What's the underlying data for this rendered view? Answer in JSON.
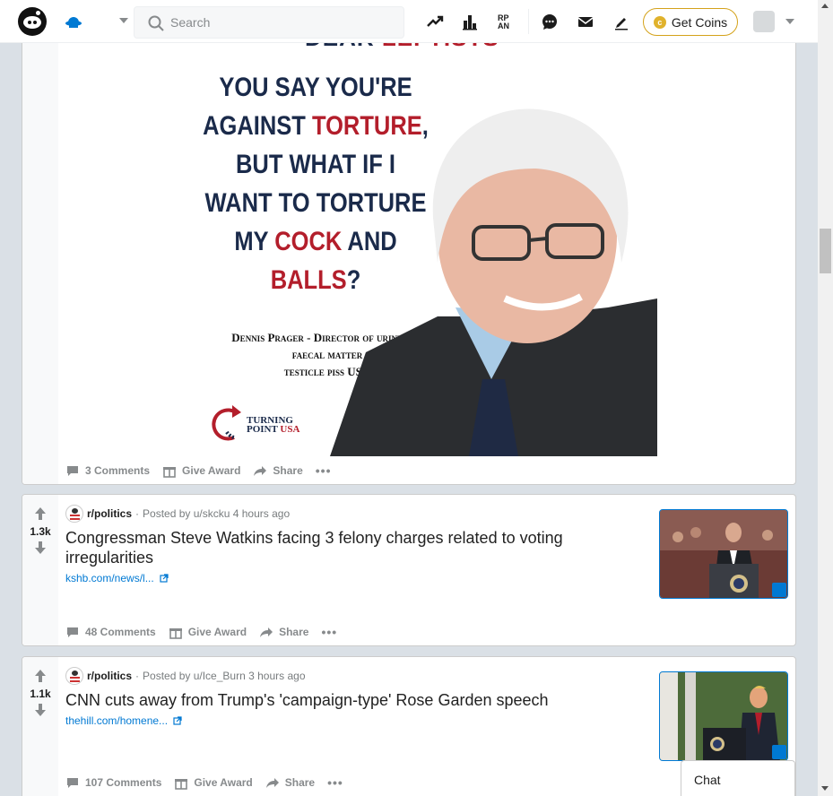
{
  "header": {
    "search_placeholder": "Search",
    "get_coins_label": "Get Coins",
    "coin_symbol": "c",
    "icons": [
      "reddit-logo-icon",
      "home-icon",
      "trending-icon",
      "stats-icon",
      "rpan-icon",
      "chat-icon",
      "mail-icon",
      "create-post-icon",
      "coin-icon",
      "avatar-icon"
    ]
  },
  "posts": [
    {
      "image": {
        "top_partial": [
          "DEAR ",
          "LEFTISTS"
        ],
        "lines": [
          [
            "YOU SAY YOU'RE"
          ],
          [
            "AGAINST ",
            "TORTURE",
            ","
          ],
          [
            "BUT WHAT IF I"
          ],
          [
            "WANT TO TORTURE"
          ],
          [
            "MY ",
            "COCK",
            " AND"
          ],
          [
            "BALLS",
            "?"
          ]
        ],
        "caption": [
          "Dennis Prager - Director of urine and",
          "faecal matter",
          "testicle piss USA"
        ],
        "logo_text": [
          "TURNING",
          "POINT",
          " USA"
        ]
      },
      "actions": {
        "comments": "3 Comments",
        "award": "Give Award",
        "share": "Share",
        "more": "•••"
      }
    },
    {
      "score": "1.3k",
      "subreddit": "r/politics",
      "posted_by": "Posted by u/skcku",
      "time": "4 hours ago",
      "title": "Congressman Steve Watkins facing 3 felony charges related to voting irregularities",
      "link": "kshb.com/news/l...",
      "actions": {
        "comments": "48 Comments",
        "award": "Give Award",
        "share": "Share",
        "more": "•••"
      }
    },
    {
      "score": "1.1k",
      "subreddit": "r/politics",
      "posted_by": "Posted by u/Ice_Burn",
      "time": "3 hours ago",
      "title": "CNN cuts away from Trump's 'campaign-type' Rose Garden speech",
      "link": "thehill.com/homene...",
      "actions": {
        "comments": "107 Comments",
        "award": "Give Award",
        "share": "Share",
        "more": "•••"
      }
    }
  ],
  "chat": {
    "label": "Chat"
  },
  "colors": {
    "accent": "#0079d3",
    "navy": "#1a2a4a",
    "red": "#b31e2b",
    "gold": "#d4a21a"
  }
}
